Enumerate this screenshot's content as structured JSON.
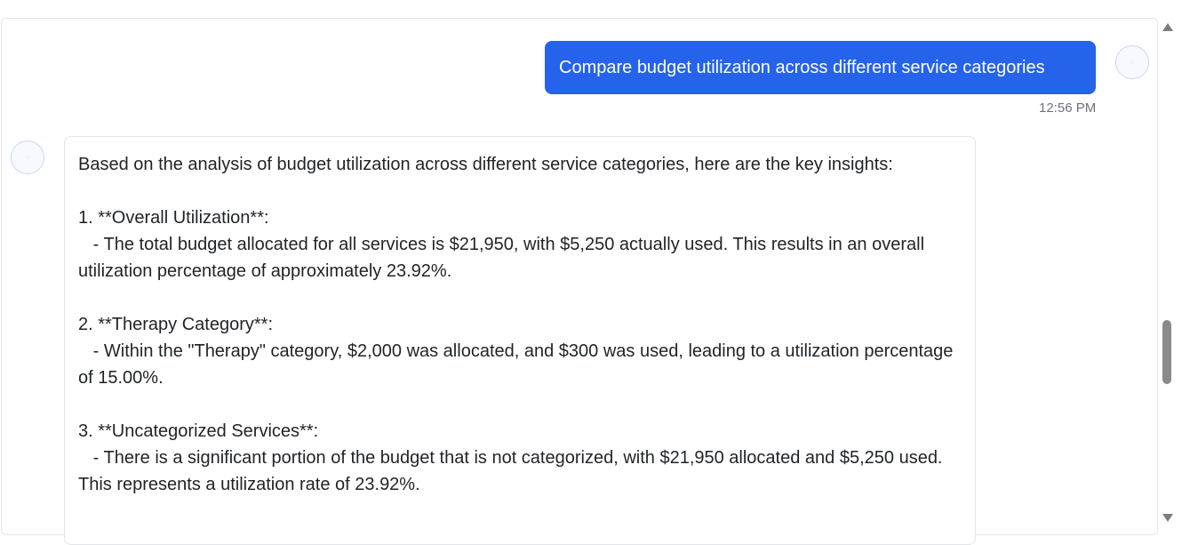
{
  "conversation": {
    "user_message": {
      "text": "Compare budget utilization across different service categories",
      "time": "12:56 PM"
    },
    "assistant_message": {
      "lines": [
        "Based on the analysis of budget utilization across different service categories, here are the key insights:",
        "",
        "1. **Overall Utilization**:",
        "   - The total budget allocated for all services is $21,950, with $5,250 actually used. This results in an overall utilization percentage of approximately 23.92%.",
        "",
        "2. **Therapy Category**:",
        "   - Within the \"Therapy\" category, $2,000 was allocated, and $300 was used, leading to a utilization percentage of 15.00%.",
        "",
        "3. **Uncategorized Services**:",
        "   - There is a significant portion of the budget that is not categorized, with $21,950 allocated and $5,250 used. This represents a utilization rate of 23.92%."
      ]
    }
  },
  "icons": {
    "user_avatar": "user-avatar-icon",
    "assistant_avatar": "assistant-avatar-icon",
    "scroll_up": "scroll-up-arrow-icon",
    "scroll_down": "scroll-down-arrow-icon"
  },
  "colors": {
    "user_bubble": "#2563eb",
    "text": "#1f2328",
    "timestamp": "#6b7280"
  }
}
